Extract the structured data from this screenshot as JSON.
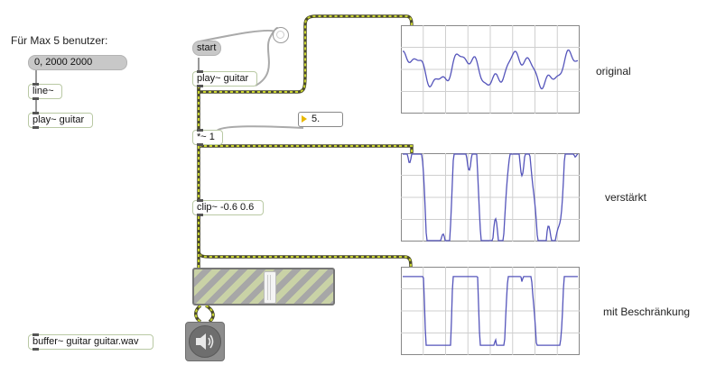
{
  "comment": "Für Max 5 benutzer:",
  "objects": {
    "msg_range": "0, 2000 2000",
    "line": "line~",
    "play_left": "play~ guitar",
    "start": "start",
    "play_main": "play~ guitar",
    "number": "5.",
    "mult": "*~ 1",
    "clip": "clip~ -0.6 0.6",
    "buffer": "buffer~ guitar guitar.wav"
  },
  "scope_labels": {
    "original": "original",
    "amplified": "verstärkt",
    "clipped": "mit Beschränkung"
  },
  "gain_level": 0.5,
  "icons": [
    "speaker-icon"
  ],
  "colors": {
    "signal_patch": "#c9d42f",
    "scope_trace": "#5555bb",
    "scope_grid": "#cfcfcf",
    "object_border": "#b9c9a4"
  }
}
